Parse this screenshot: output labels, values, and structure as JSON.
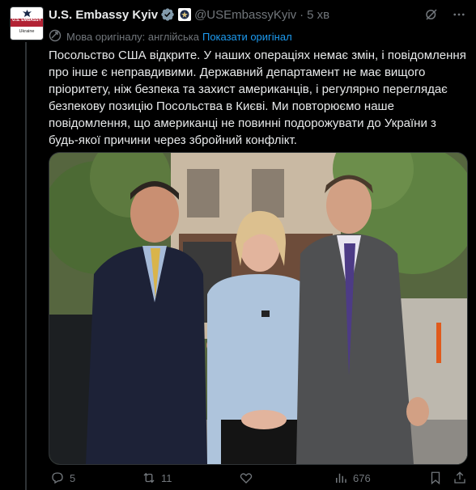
{
  "account": {
    "name": "U.S. Embassy Kyiv",
    "handle": "@USEmbassyKyiv",
    "time": "5 хв",
    "avatar_text_top": "U.S. EMBASSY",
    "avatar_text_bottom": "Ukraine"
  },
  "translation": {
    "label": "Мова оригіналу: англійська",
    "show_original": "Показати оригінал"
  },
  "post": {
    "text": "Посольство США відкрите.  У наших операціях немає змін, і повідомлення про інше є неправдивими. Державний департамент не має вищого пріоритету, ніж безпека та захист американців, і регулярно переглядає безпекову позицію Посольства в Києві.  Ми повторюємо наше повідомлення, що американці не повинні подорожувати до України з будь-якої причини через збройний конфлікт."
  },
  "actions": {
    "replies": "5",
    "reposts": "11",
    "likes": "",
    "views": "676"
  },
  "colors": {
    "background": "#000000",
    "text": "#e7e9ea",
    "muted": "#71767b",
    "link": "#1d9bf0",
    "verified": "#829aab",
    "border": "#2f3336"
  },
  "icons": [
    "verified-badge-icon",
    "affiliate-seal-icon",
    "grok-icon",
    "more-icon",
    "translate-icon",
    "reply-icon",
    "repost-icon",
    "like-icon",
    "views-icon",
    "bookmark-icon",
    "share-icon"
  ]
}
